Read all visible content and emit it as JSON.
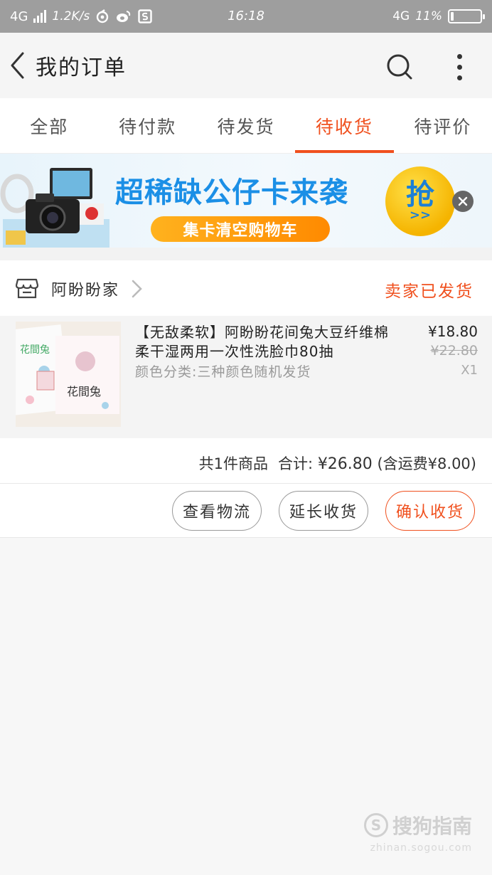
{
  "status_bar": {
    "network": "4G",
    "speed": "1.2K/s",
    "time": "16:18",
    "network_right": "4G",
    "battery_percent": "11%",
    "battery_level": 0.11
  },
  "nav": {
    "title": "我的订单"
  },
  "tabs": [
    {
      "label": "全部"
    },
    {
      "label": "待付款"
    },
    {
      "label": "待发货"
    },
    {
      "label": "待收货"
    },
    {
      "label": "待评价"
    }
  ],
  "active_tab_index": 3,
  "banner": {
    "headline": "超稀缺公仔卡来袭",
    "subline": "集卡清空购物车",
    "grab_label": "抢",
    "grab_arrow": ">>"
  },
  "order": {
    "shop_name": "阿盼盼家",
    "status": "卖家已发货",
    "product": {
      "title": "【无敌柔软】阿盼盼花间兔大豆纤维棉柔干湿两用一次性洗脸巾80抽",
      "variant": "颜色分类:三种颜色随机发货",
      "price": "¥18.80",
      "original_price": "¥22.80",
      "quantity": "X1"
    },
    "summary": {
      "items_count": "共1件商品",
      "total_label": "合计:",
      "total_amount": "¥26.80",
      "shipping_note": "(含运费¥8.00)"
    },
    "actions": {
      "logistics": "查看物流",
      "extend": "延长收货",
      "confirm": "确认收货"
    }
  },
  "watermark": {
    "brand": "搜狗指南",
    "url": "zhinan.sogou.com"
  },
  "colors": {
    "accent": "#f0501e",
    "status_bar": "#9e9e9e",
    "banner_blue": "#1b8fe6",
    "banner_orange": "#ff8a00"
  },
  "icons": {
    "back": "chevron-left-icon",
    "search": "search-icon",
    "more": "more-vertical-icon",
    "shop": "store-icon",
    "chevron": "chevron-right-icon",
    "close": "close-icon"
  }
}
